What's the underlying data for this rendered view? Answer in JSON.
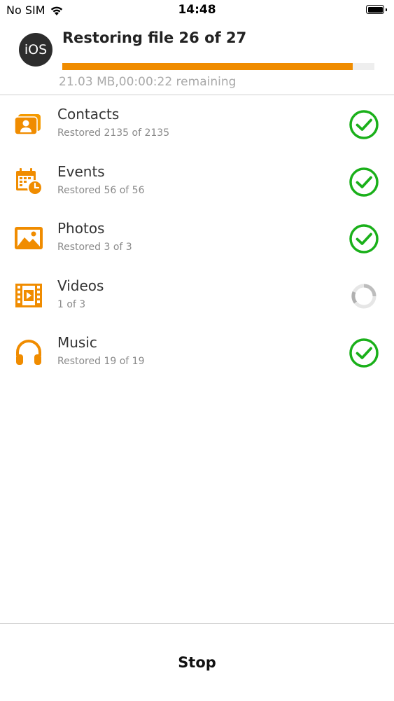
{
  "status_bar": {
    "carrier": "No SIM",
    "time": "14:48",
    "wifi_icon": "wifi-icon",
    "battery_icon": "battery-icon"
  },
  "header": {
    "device_label": "iOS",
    "title": "Restoring file 26 of 27",
    "progress_percent": 93,
    "progress_text": "21.03 MB,00:00:22 remaining",
    "accent_color": "#f08c00"
  },
  "items": [
    {
      "title": "Contacts",
      "subtitle": "Restored 2135 of 2135",
      "icon": "contacts-icon",
      "status": "done"
    },
    {
      "title": "Events",
      "subtitle": "Restored 56 of 56",
      "icon": "calendar-icon",
      "status": "done"
    },
    {
      "title": "Photos",
      "subtitle": "Restored 3 of 3",
      "icon": "photo-icon",
      "status": "done"
    },
    {
      "title": "Videos",
      "subtitle": "1 of 3",
      "icon": "video-icon",
      "status": "in-progress"
    },
    {
      "title": "Music",
      "subtitle": "Restored 19 of 19",
      "icon": "headphones-icon",
      "status": "done"
    }
  ],
  "status_colors": {
    "done": "#1ab01a",
    "in_progress": "#c8c8c8"
  },
  "footer": {
    "stop_label": "Stop"
  }
}
